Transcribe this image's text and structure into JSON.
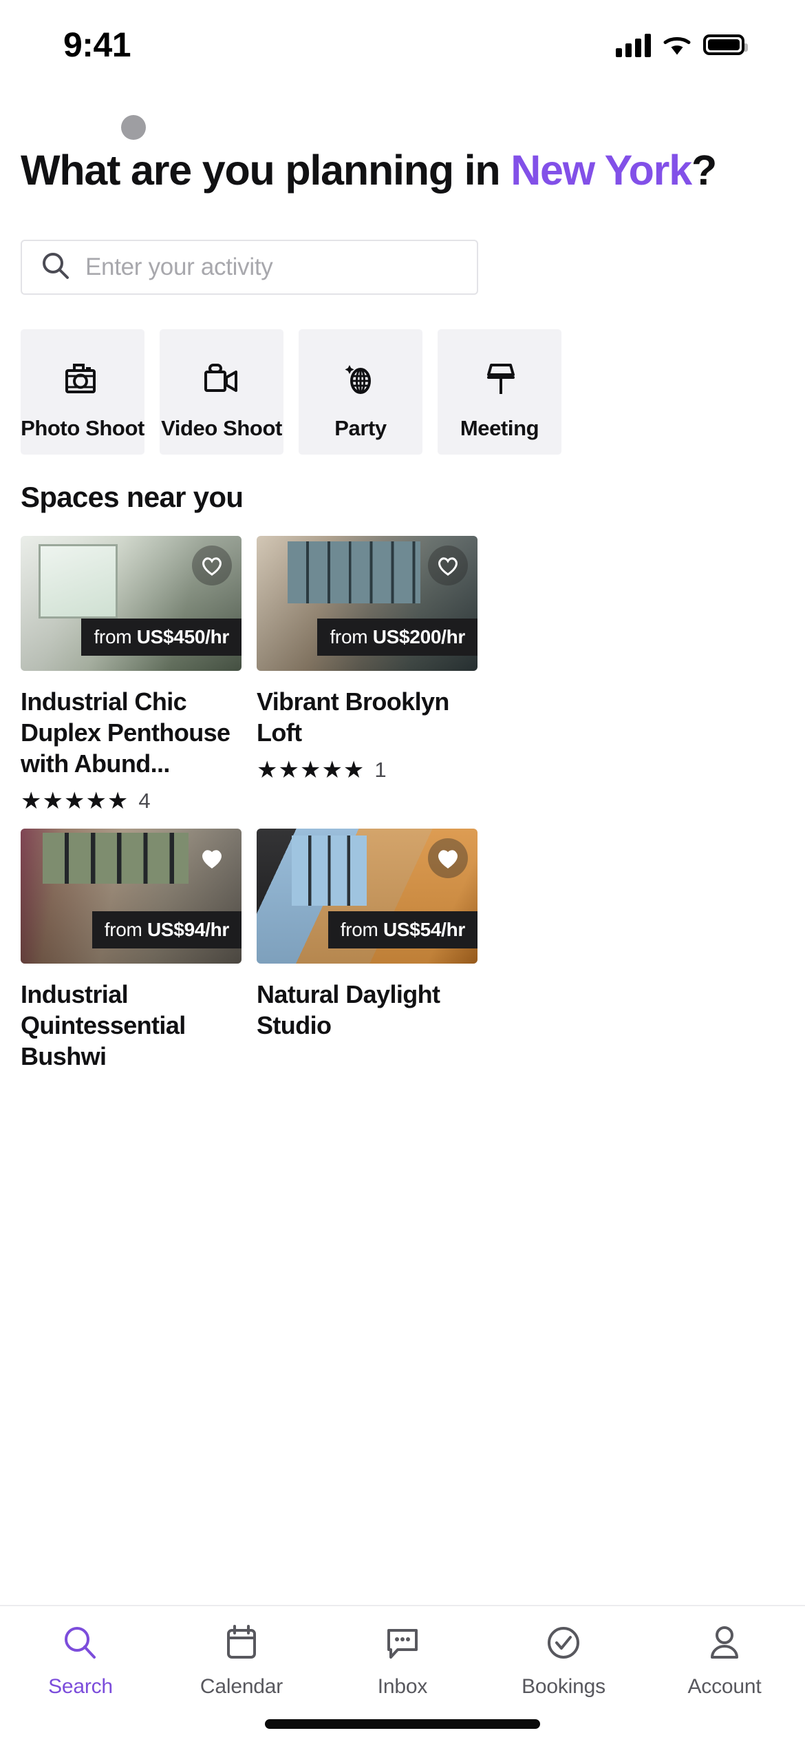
{
  "status_bar": {
    "time": "9:41",
    "signal_icon": "cellular-signal-icon",
    "wifi_icon": "wifi-icon",
    "battery_icon": "battery-icon"
  },
  "header": {
    "avatar_name": "avatar",
    "headline_prefix": "What are you planning in ",
    "headline_city": "New York",
    "headline_suffix": "?",
    "city_color": "#8250E8"
  },
  "search": {
    "icon": "search-icon",
    "placeholder": "Enter your activity",
    "value": ""
  },
  "categories": [
    {
      "label": "Photo Shoot",
      "icon": "camera-icon"
    },
    {
      "label": "Video Shoot",
      "icon": "video-camera-icon"
    },
    {
      "label": "Party",
      "icon": "disco-ball-icon"
    },
    {
      "label": "Meeting",
      "icon": "lamp-icon"
    }
  ],
  "spaces_section": {
    "title": "Spaces near you"
  },
  "listings": [
    {
      "title": "Industrial Chic Duplex Penthouse with Abund...",
      "price": "from US$450/hr",
      "price_prefix": "from ",
      "price_amount": "US$450/hr",
      "stars": "★★★★★",
      "review_count": "4",
      "favorite_icon": "heart-icon",
      "favorited": false
    },
    {
      "title": "Vibrant Brooklyn Loft",
      "price": "from US$200/hr",
      "price_prefix": "from ",
      "price_amount": "US$200/hr",
      "stars": "★★★★★",
      "review_count": "1",
      "favorite_icon": "heart-icon",
      "favorited": false
    },
    {
      "title": "Industrial Quintessential Bushwi",
      "price": "from US$94/hr",
      "price_prefix": "from ",
      "price_amount": "US$94/hr",
      "stars": "",
      "review_count": "",
      "favorite_icon": "heart-icon",
      "favorited": true
    },
    {
      "title": "Natural Daylight Studio",
      "price": "from US$54/hr",
      "price_prefix": "from ",
      "price_amount": "US$54/hr",
      "stars": "",
      "review_count": "",
      "favorite_icon": "heart-icon",
      "favorited": true
    }
  ],
  "tabbar": {
    "active_color": "#7C4DDB",
    "inactive_color": "#58585E",
    "items": [
      {
        "label": "Search",
        "icon": "search-icon",
        "active": true
      },
      {
        "label": "Calendar",
        "icon": "calendar-icon",
        "active": false
      },
      {
        "label": "Inbox",
        "icon": "chat-bubble-icon",
        "active": false
      },
      {
        "label": "Bookings",
        "icon": "check-circle-icon",
        "active": false
      },
      {
        "label": "Account",
        "icon": "person-icon",
        "active": false
      }
    ]
  }
}
